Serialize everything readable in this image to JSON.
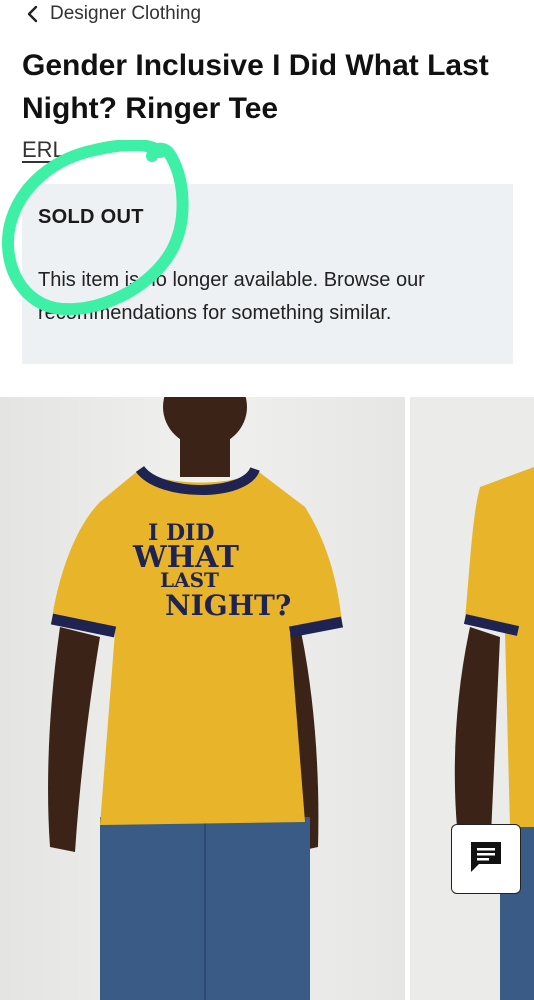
{
  "breadcrumb": {
    "label": "Designer Clothing"
  },
  "product": {
    "title": "Gender Inclusive I Did What Last Night? Ringer Tee",
    "brand": "ERL",
    "shirt_print": [
      "I DID",
      "WHAT",
      "LAST",
      "NIGHT?"
    ]
  },
  "notice": {
    "heading": "SOLD OUT",
    "message": "This item is no longer available. Browse our recommendations for something similar."
  },
  "colors": {
    "annotation": "#3ef0a6",
    "notice_bg": "#eef1f4",
    "shirt": "#e8b52a",
    "trim": "#1f2352"
  },
  "icons": {
    "back": "chevron-left-icon",
    "chat": "chat-icon"
  }
}
